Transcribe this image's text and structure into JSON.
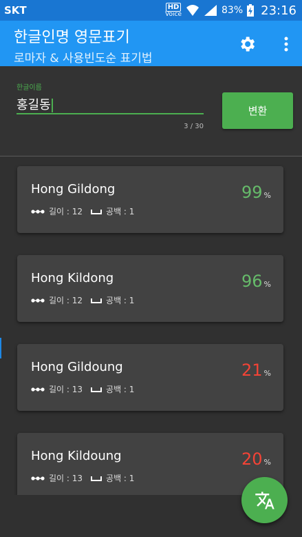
{
  "status": {
    "carrier": "SKT",
    "hd": "HD",
    "voice": "Voice",
    "battery": "83%",
    "time": "23:16"
  },
  "appbar": {
    "title": "한글인명 영문표기",
    "subtitle": "로마자 & 사용빈도순 표기법",
    "settings_icon": "gear-icon",
    "more_icon": "more-vert-icon"
  },
  "input": {
    "label": "한글이름",
    "value": "홍길동",
    "counter": "3 / 30",
    "convert_label": "변환"
  },
  "results": [
    {
      "name": "Hong Gildong",
      "score": "99",
      "unit": "%",
      "length_label": "길이 : 12",
      "space_label": "공백 : 1",
      "color": "#66bb6a"
    },
    {
      "name": "Hong Kildong",
      "score": "96",
      "unit": "%",
      "length_label": "길이 : 12",
      "space_label": "공백 : 1",
      "color": "#66bb6a"
    },
    {
      "name": "Hong Gildoung",
      "score": "21",
      "unit": "%",
      "length_label": "길이 : 13",
      "space_label": "공백 : 1",
      "color": "#f44336"
    },
    {
      "name": "Hong Kildoung",
      "score": "20",
      "unit": "%",
      "length_label": "길이 : 13",
      "space_label": "공백 : 1",
      "color": "#f44336"
    }
  ],
  "fab": {
    "icon": "translate-icon"
  },
  "colors": {
    "primary": "#2196f3",
    "primary_dark": "#1976d2",
    "accent": "#4caf50",
    "background": "#303030",
    "card": "#424242"
  }
}
